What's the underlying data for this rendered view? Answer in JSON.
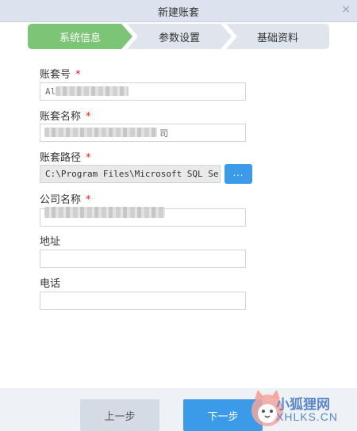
{
  "window": {
    "title": "新建账套",
    "close_icon": "×"
  },
  "steps": [
    {
      "label": "系统信息",
      "active": true
    },
    {
      "label": "参数设置",
      "active": false
    },
    {
      "label": "基础资料",
      "active": false
    }
  ],
  "colors": {
    "active_step": "#7cc576",
    "inactive_step": "#e0e5ed",
    "primary_button": "#3c9be8",
    "required": "#e02020"
  },
  "form": {
    "account_no": {
      "label": "账套号",
      "required": "*",
      "value": "Al"
    },
    "account_name": {
      "label": "账套名称",
      "required": "*",
      "value_suffix": "司"
    },
    "account_path": {
      "label": "账套路径",
      "required": "*",
      "value": "C:\\Program Files\\Microsoft SQL Serve",
      "browse_label": "..."
    },
    "company_name": {
      "label": "公司名称",
      "required": "*"
    },
    "address": {
      "label": "地址",
      "value": ""
    },
    "phone": {
      "label": "电话",
      "value": ""
    }
  },
  "footer": {
    "prev_label": "上一步",
    "next_label": "下一步"
  },
  "watermark": {
    "line1": "小狐狸网",
    "line2": "XHLKS.CN"
  }
}
